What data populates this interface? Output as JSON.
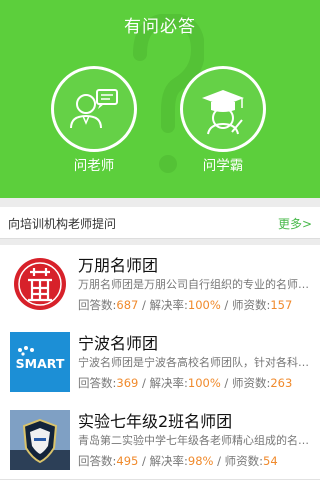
{
  "header": {
    "title": "有问必答"
  },
  "actions": [
    {
      "label": "问老师",
      "icon": "teacher-icon"
    },
    {
      "label": "问学霸",
      "icon": "graduate-icon"
    }
  ],
  "section": {
    "title": "向培训机构老师提问",
    "more": "更多>"
  },
  "stat_labels": {
    "answers": "回答数:",
    "sep1": " / ",
    "rate": "解决率:",
    "sep2": " / ",
    "teachers": "师资数:"
  },
  "colors": {
    "brand_green": "#5ccf3c",
    "number_orange": "#f08a2c",
    "link_green": "#48b94a"
  },
  "teams": [
    {
      "name": "万朋名师团",
      "desc": "万朋名师团是万朋公司自行组织的专业的名师团队",
      "answers": "687",
      "rate": "100%",
      "teachers": "157",
      "logo": "wanpeng-seal-logo"
    },
    {
      "name": "宁波名师团",
      "desc": "宁波名师团是宁波各高校名师团队，针对各科目进…",
      "answers": "369",
      "rate": "100%",
      "teachers": "263",
      "logo": "smart-logo",
      "logo_text": "SMART"
    },
    {
      "name": "实验七年级2班名师团",
      "desc": "青岛第二实验中学七年级各老师精心组成的名师团…",
      "answers": "495",
      "rate": "98%",
      "teachers": "54",
      "logo": "school-badge-logo"
    }
  ]
}
